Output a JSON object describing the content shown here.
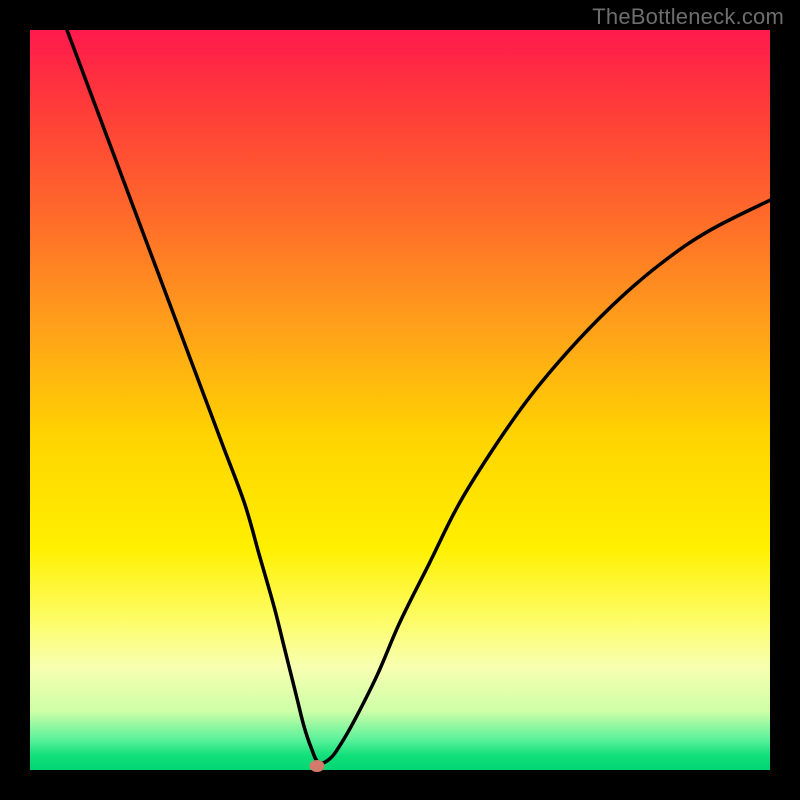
{
  "watermark": "TheBottleneck.com",
  "chart_data": {
    "type": "line",
    "title": "",
    "xlabel": "",
    "ylabel": "",
    "xlim": [
      0,
      100
    ],
    "ylim": [
      0,
      100
    ],
    "gradient_stops": [
      {
        "pos": 0,
        "color": "#ff1a4d"
      },
      {
        "pos": 10,
        "color": "#ff3a3a"
      },
      {
        "pos": 25,
        "color": "#ff6a2a"
      },
      {
        "pos": 40,
        "color": "#ffa01a"
      },
      {
        "pos": 55,
        "color": "#ffd400"
      },
      {
        "pos": 70,
        "color": "#fff000"
      },
      {
        "pos": 80,
        "color": "#fdfd6a"
      },
      {
        "pos": 86,
        "color": "#f8ffb0"
      },
      {
        "pos": 92,
        "color": "#cfffa8"
      },
      {
        "pos": 96,
        "color": "#57f09a"
      },
      {
        "pos": 98,
        "color": "#13e07a"
      },
      {
        "pos": 100,
        "color": "#00d673"
      }
    ],
    "series": [
      {
        "name": "bottleneck-curve",
        "x": [
          5,
          8,
          11,
          14,
          17,
          20,
          23,
          26,
          29,
          31,
          33,
          34.5,
          36,
          37,
          38,
          39,
          40.5,
          42,
          44,
          47,
          50,
          54,
          58,
          63,
          68,
          74,
          80,
          86,
          92,
          100
        ],
        "y": [
          100,
          92,
          84,
          76,
          68,
          60,
          52,
          44,
          36,
          29,
          22,
          16,
          10,
          6,
          3,
          1,
          1.5,
          3.5,
          7,
          13,
          20,
          28,
          36,
          44,
          51,
          58,
          64,
          69,
          73,
          77
        ]
      }
    ],
    "marker": {
      "x": 38.8,
      "y": 0.5,
      "color": "#d47a6a"
    }
  }
}
